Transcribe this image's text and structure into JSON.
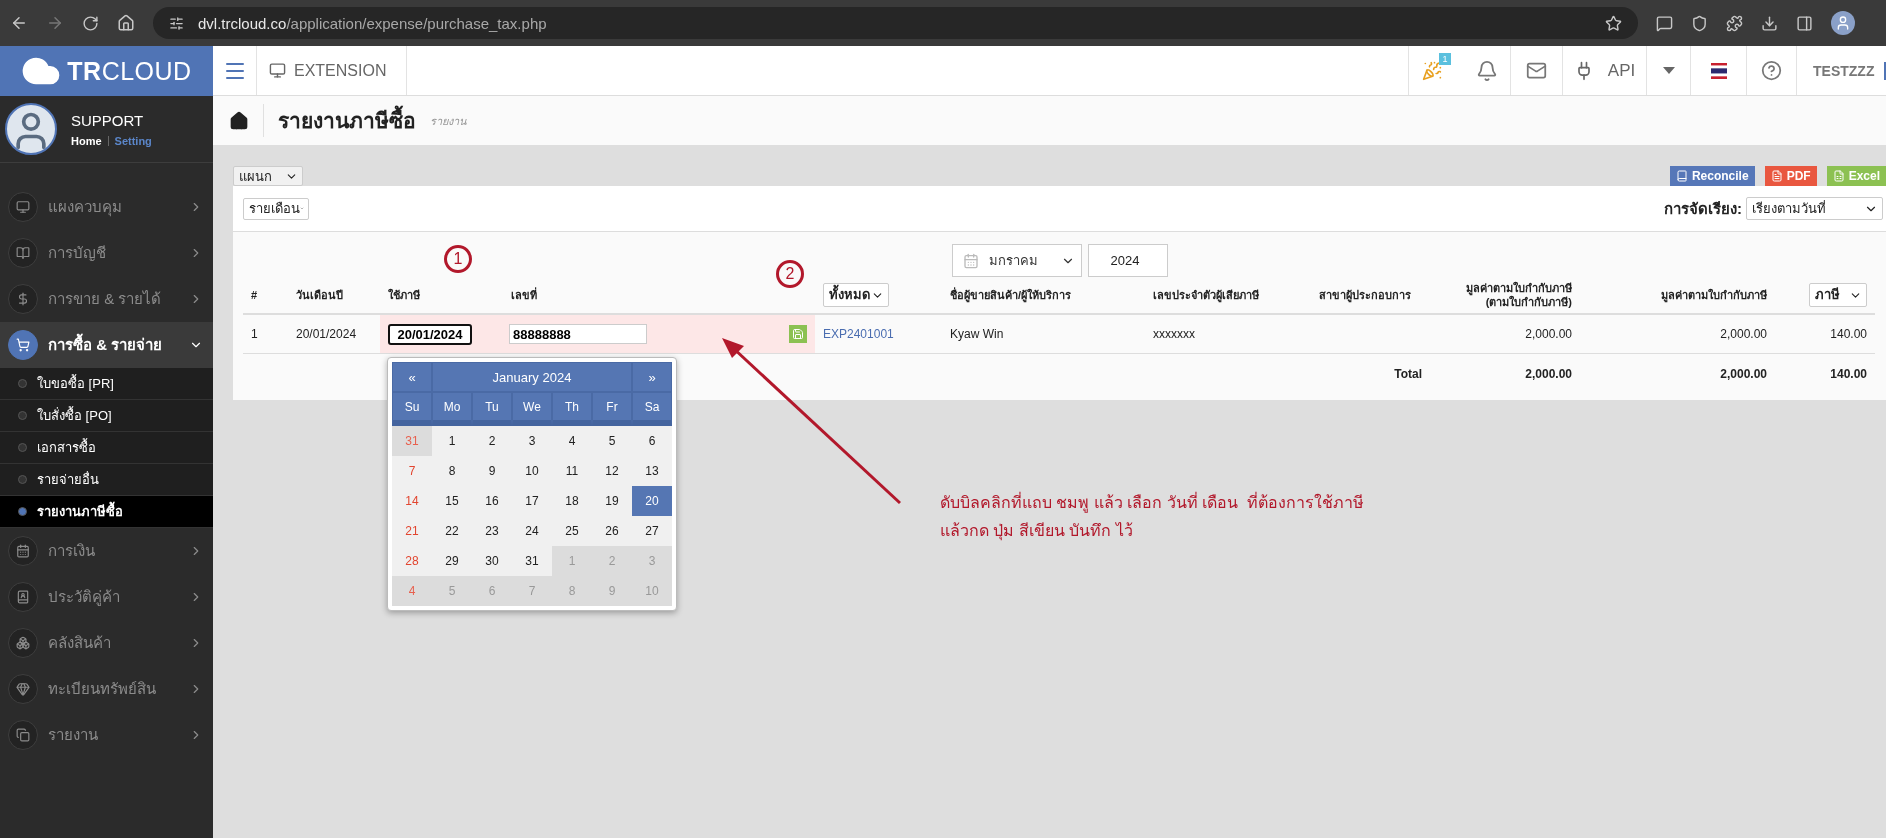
{
  "browser": {
    "url_domain": "dvl.trcloud.co",
    "url_path": "/application/expense/purchase_tax.php"
  },
  "header": {
    "logo": "**TR**CLOUD",
    "extension": "EXTENSION",
    "notification_count": "1",
    "api": "API",
    "user": "TESTZZZ"
  },
  "sidebar": {
    "profile": {
      "name": "SUPPORT",
      "home": "Home",
      "setting": "Setting"
    },
    "items": [
      {
        "label": "แผงควบคุม",
        "selected": false,
        "expanded": false
      },
      {
        "label": "การบัญชี",
        "selected": false,
        "expanded": false
      },
      {
        "label": "การขาย & รายได้",
        "selected": false,
        "expanded": false
      },
      {
        "label": "การซื้อ & รายจ่าย",
        "selected": true,
        "expanded": true,
        "children": [
          {
            "label": "ใบขอซื้อ [PR]",
            "selected": false
          },
          {
            "label": "ใบสั่งซื้อ [PO]",
            "selected": false
          },
          {
            "label": "เอกสารซื้อ",
            "selected": false
          },
          {
            "label": "รายจ่ายอื่น",
            "selected": false
          },
          {
            "label": "รายงานภาษีซื้อ",
            "selected": true
          }
        ]
      },
      {
        "label": "การเงิน",
        "selected": false,
        "expanded": false
      },
      {
        "label": "ประวัติคู่ค้า",
        "selected": false,
        "expanded": false
      },
      {
        "label": "คลังสินค้า",
        "selected": false,
        "expanded": false
      },
      {
        "label": "ทะเบียนทรัพย์สิน",
        "selected": false,
        "expanded": false
      },
      {
        "label": "รายงาน",
        "selected": false,
        "expanded": false
      }
    ]
  },
  "page": {
    "title": "รายงานภาษีซื้อ",
    "subtitle": "รายงาน"
  },
  "toolbar": {
    "department_select": "แผนก",
    "buttons": [
      {
        "label": "Reconcile",
        "kind": "reconcile",
        "color": "#5677b8"
      },
      {
        "label": "PDF",
        "kind": "pdf",
        "color": "#e9573f"
      },
      {
        "label": "Excel",
        "kind": "excel",
        "color": "#8cc152"
      }
    ],
    "period_select": "รายเดือน",
    "sort_label": "การจัดเรียง:",
    "sort_select": "เรียงตามวันที่"
  },
  "filter": {
    "month": "มกราคม",
    "year": "2024"
  },
  "table": {
    "columns": [
      {
        "label": "#",
        "kind": "text"
      },
      {
        "label": "วันเดือนปี",
        "kind": "text"
      },
      {
        "label": "ใช้ภาษี",
        "kind": "text"
      },
      {
        "label": "เลขที่",
        "kind": "text"
      },
      {
        "label": "ทั้งหมด",
        "kind": "select"
      },
      {
        "label": "ชื่อผู้ขายสินค้า/ผู้ให้บริการ",
        "kind": "text"
      },
      {
        "label": "เลขประจำตัวผู้เสียภาษี",
        "kind": "text"
      },
      {
        "label": "สาขาผู้ประกอบการ",
        "kind": "text"
      },
      {
        "label": "มูลค่าตามใบกำกับภาษี\n(ตามใบกำกับภาษี)",
        "kind": "number"
      },
      {
        "label": "มูลค่าตามใบกำกับภาษี",
        "kind": "number"
      },
      {
        "label": "ภาษี",
        "kind": "select"
      }
    ],
    "rows": [
      {
        "number": "1",
        "date": "20/01/2024",
        "tax_date": "20/01/2024",
        "doc_no": "88888888",
        "highlighted": true,
        "doc_link": "EXP2401001",
        "vendor": "Kyaw Win",
        "tax_id": "xxxxxxx",
        "value_invoice": "2,000.00",
        "value": "2,000.00",
        "tax": "140.00"
      }
    ],
    "total": {
      "label": "Total",
      "values": [
        "2,000.00",
        "2,000.00",
        "140.00"
      ]
    }
  },
  "calendar": {
    "prev": "«",
    "title": "January 2024",
    "next": "»",
    "weekdays": [
      "Su",
      "Mo",
      "Tu",
      "We",
      "Th",
      "Fr",
      "Sa"
    ],
    "weeks": [
      [
        {
          "day": "31",
          "other_month": true,
          "selected": false
        },
        {
          "day": "1",
          "other_month": false,
          "selected": false
        },
        {
          "day": "2",
          "other_month": false,
          "selected": false
        },
        {
          "day": "3",
          "other_month": false,
          "selected": false
        },
        {
          "day": "4",
          "other_month": false,
          "selected": false
        },
        {
          "day": "5",
          "other_month": false,
          "selected": false
        },
        {
          "day": "6",
          "other_month": false,
          "selected": false
        }
      ],
      [
        {
          "day": "7",
          "other_month": false,
          "selected": false
        },
        {
          "day": "8",
          "other_month": false,
          "selected": false
        },
        {
          "day": "9",
          "other_month": false,
          "selected": false
        },
        {
          "day": "10",
          "other_month": false,
          "selected": false
        },
        {
          "day": "11",
          "other_month": false,
          "selected": false
        },
        {
          "day": "12",
          "other_month": false,
          "selected": false
        },
        {
          "day": "13",
          "other_month": false,
          "selected": false
        }
      ],
      [
        {
          "day": "14",
          "other_month": false,
          "selected": false
        },
        {
          "day": "15",
          "other_month": false,
          "selected": false
        },
        {
          "day": "16",
          "other_month": false,
          "selected": false
        },
        {
          "day": "17",
          "other_month": false,
          "selected": false
        },
        {
          "day": "18",
          "other_month": false,
          "selected": false
        },
        {
          "day": "19",
          "other_month": false,
          "selected": false
        },
        {
          "day": "20",
          "other_month": false,
          "selected": true
        }
      ],
      [
        {
          "day": "21",
          "other_month": false,
          "selected": false
        },
        {
          "day": "22",
          "other_month": false,
          "selected": false
        },
        {
          "day": "23",
          "other_month": false,
          "selected": false
        },
        {
          "day": "24",
          "other_month": false,
          "selected": false
        },
        {
          "day": "25",
          "other_month": false,
          "selected": false
        },
        {
          "day": "26",
          "other_month": false,
          "selected": false
        },
        {
          "day": "27",
          "other_month": false,
          "selected": false
        }
      ],
      [
        {
          "day": "28",
          "other_month": false,
          "selected": false
        },
        {
          "day": "29",
          "other_month": false,
          "selected": false
        },
        {
          "day": "30",
          "other_month": false,
          "selected": false
        },
        {
          "day": "31",
          "other_month": false,
          "selected": false
        },
        {
          "day": "1",
          "other_month": true,
          "selected": false
        },
        {
          "day": "2",
          "other_month": true,
          "selected": false
        },
        {
          "day": "3",
          "other_month": true,
          "selected": false
        }
      ],
      [
        {
          "day": "4",
          "other_month": true,
          "selected": false
        },
        {
          "day": "5",
          "other_month": true,
          "selected": false
        },
        {
          "day": "6",
          "other_month": true,
          "selected": false
        },
        {
          "day": "7",
          "other_month": true,
          "selected": false
        },
        {
          "day": "8",
          "other_month": true,
          "selected": false
        },
        {
          "day": "9",
          "other_month": true,
          "selected": false
        },
        {
          "day": "10",
          "other_month": true,
          "selected": false
        }
      ]
    ]
  },
  "annotations": {
    "markers": [
      "1",
      "2"
    ],
    "note_lines": [
      "ดับบิลคลิกที่แถบ ชมพู แล้ว เลือก วันที่ เดือน  ที่ต้องการใช้ภาษี",
      "แล้วกด ปุ่ม สีเขียน บันทึก ไว้"
    ]
  }
}
